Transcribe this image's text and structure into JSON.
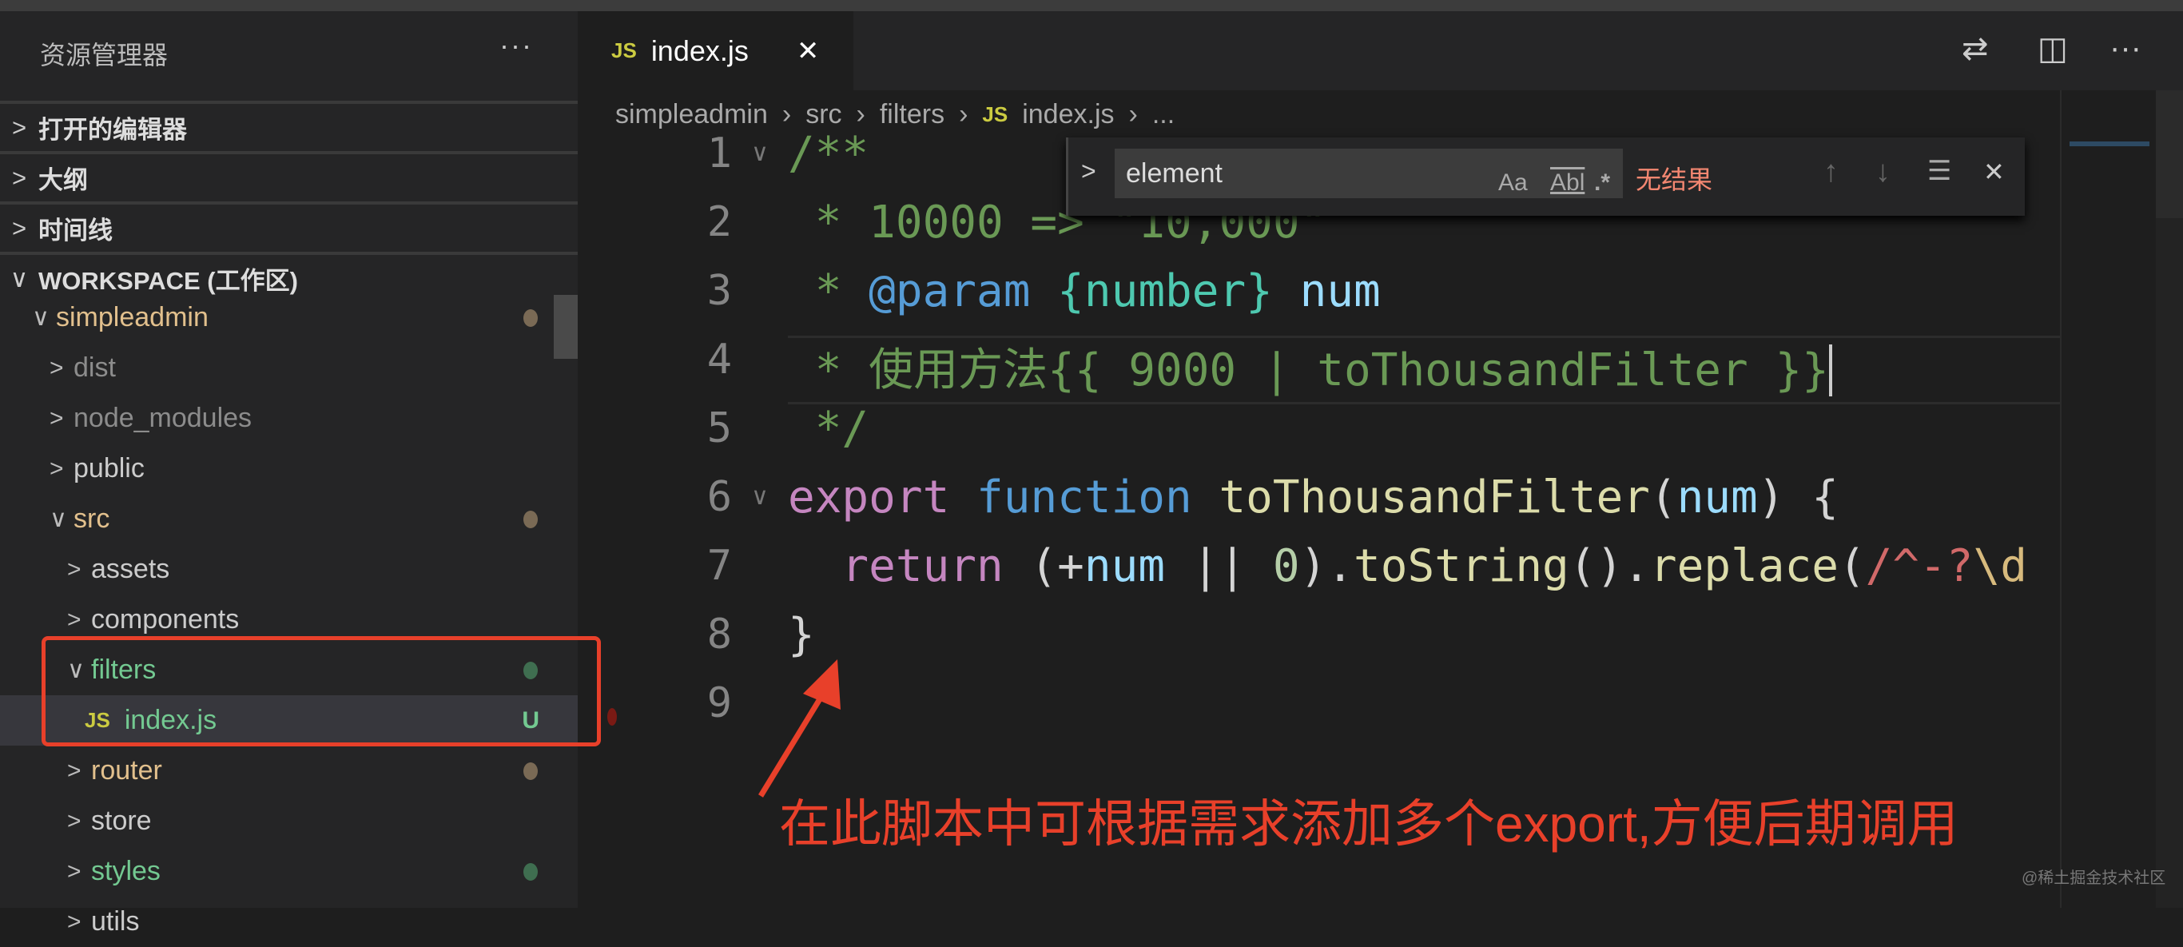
{
  "sidebar": {
    "title": "资源管理器",
    "more": "···",
    "sections": [
      {
        "label": "打开的编辑器",
        "chev": ">"
      },
      {
        "label": "大纲",
        "chev": ">"
      },
      {
        "label": "时间线",
        "chev": ">"
      },
      {
        "label": "WORKSPACE (工作区)",
        "chev": "∨"
      }
    ],
    "tree": [
      {
        "label": "simpleadmin",
        "depth": 0,
        "chev": "∨",
        "color": "#e2c08d",
        "dot": "#7a6a55"
      },
      {
        "label": "dist",
        "depth": 1,
        "chev": ">",
        "color": "#8c8c8c"
      },
      {
        "label": "node_modules",
        "depth": 1,
        "chev": ">",
        "color": "#8c8c8c"
      },
      {
        "label": "public",
        "depth": 1,
        "chev": ">",
        "color": "#cccccc"
      },
      {
        "label": "src",
        "depth": 1,
        "chev": "∨",
        "color": "#e2c08d",
        "dot": "#7a6a55"
      },
      {
        "label": "assets",
        "depth": 2,
        "chev": ">",
        "color": "#cccccc"
      },
      {
        "label": "components",
        "depth": 2,
        "chev": ">",
        "color": "#cccccc"
      },
      {
        "label": "filters",
        "depth": 2,
        "chev": "∨",
        "color": "#73c991",
        "dot": "#3f6e50"
      },
      {
        "label": "index.js",
        "depth": 3,
        "js": "JS",
        "color": "#73c991",
        "badge": "U",
        "selected": true
      },
      {
        "label": "router",
        "depth": 2,
        "chev": ">",
        "color": "#e2c08d",
        "dot": "#7a6a55"
      },
      {
        "label": "store",
        "depth": 2,
        "chev": ">",
        "color": "#cccccc"
      },
      {
        "label": "styles",
        "depth": 2,
        "chev": ">",
        "color": "#73c991",
        "dot": "#3f6e50"
      },
      {
        "label": "utils",
        "depth": 2,
        "chev": ">",
        "color": "#cccccc"
      }
    ]
  },
  "tab": {
    "icon": "JS",
    "label": "index.js",
    "close": "✕"
  },
  "toolbar": {
    "compare": "⇄",
    "split": "◫",
    "more": "···"
  },
  "breadcrumb": [
    "simpleadmin",
    "src",
    "filters",
    "index.js",
    "..."
  ],
  "find": {
    "value": "element",
    "match_case": "Aa",
    "whole_word": "Abl",
    "regex": ".*",
    "result": "无结果",
    "prev": "↑",
    "next": "↓",
    "selection": "☰",
    "close": "✕",
    "toggle": ">"
  },
  "code": [
    [
      [
        "/**",
        "#6a9955"
      ]
    ],
    [
      [
        " * 10000 => \"10,000\"",
        "#6a9955"
      ]
    ],
    [
      [
        " * ",
        "#6a9955"
      ],
      [
        "@param",
        "#569cd6"
      ],
      [
        " ",
        "#6a9955"
      ],
      [
        "{number}",
        "#4ec9b0"
      ],
      [
        " num",
        "#9cdcfe"
      ]
    ],
    [
      [
        " * 使用方法{{ 9000 | toThousandFilter }}",
        "#6a9955"
      ]
    ],
    [
      [
        " */",
        "#6a9955"
      ]
    ],
    [
      [
        "export",
        "#c586c0"
      ],
      [
        " ",
        "#d4d4d4"
      ],
      [
        "function",
        "#569cd6"
      ],
      [
        " ",
        "#d4d4d4"
      ],
      [
        "toThousandFilter",
        "#dcdcaa"
      ],
      [
        "(",
        "#d4d4d4"
      ],
      [
        "num",
        "#9cdcfe"
      ],
      [
        ") {",
        "#d4d4d4"
      ]
    ],
    [
      [
        "  return",
        "#c586c0"
      ],
      [
        " (+",
        "#d4d4d4"
      ],
      [
        "num",
        "#9cdcfe"
      ],
      [
        " || ",
        "#d4d4d4"
      ],
      [
        "0",
        "#b5cea8"
      ],
      [
        ").",
        "#d4d4d4"
      ],
      [
        "toString",
        "#dcdcaa"
      ],
      [
        "().",
        "#d4d4d4"
      ],
      [
        "replace",
        "#dcdcaa"
      ],
      [
        "(",
        "#d4d4d4"
      ],
      [
        "/^-?",
        "#d16969"
      ],
      [
        "\\d",
        "#d7ba7d"
      ]
    ],
    [
      [
        "}",
        "#d4d4d4"
      ]
    ],
    []
  ],
  "annotation": "在此脚本中可根据需求添加多个export,方便后期调用",
  "watermark": "@稀土掘金技术社区",
  "accent": "#e8402a"
}
